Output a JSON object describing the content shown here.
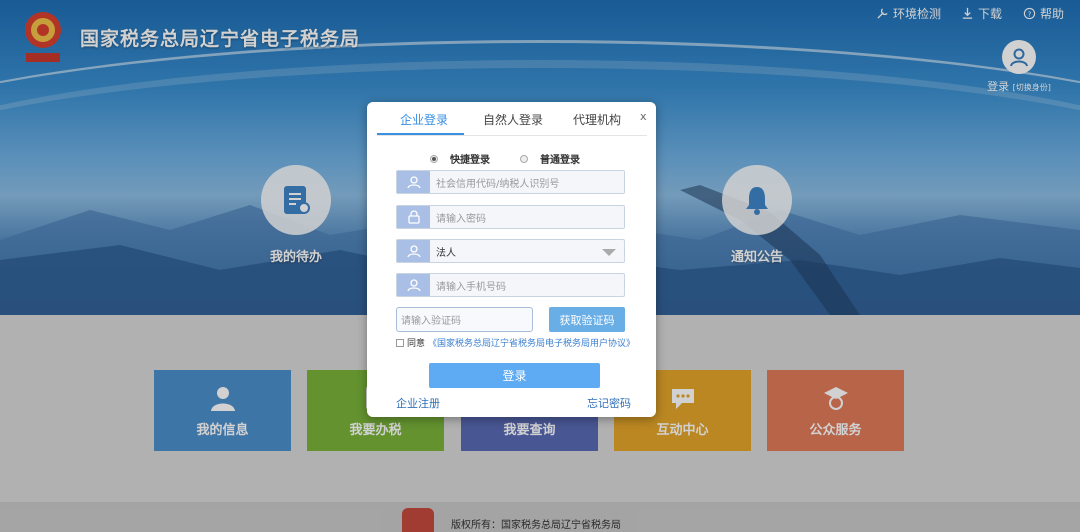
{
  "header": {
    "site_title": "国家税务总局辽宁省电子税务局",
    "links": [
      "环境检测",
      "下载",
      "帮助"
    ],
    "login": "登录",
    "switch_identity": "[切换身份]"
  },
  "hero": {
    "left_label": "我的待办",
    "right_label": "通知公告"
  },
  "tiles": [
    {
      "label": "我的信息",
      "color": "#4c8fcc"
    },
    {
      "label": "我要办税",
      "color": "#79b23a"
    },
    {
      "label": "我要查询",
      "color": "#5869b4"
    },
    {
      "label": "互动中心",
      "color": "#e3a52a"
    },
    {
      "label": "公众服务",
      "color": "#e07a5a"
    }
  ],
  "dialog": {
    "tabs": [
      "企业登录",
      "自然人登录",
      "代理机构"
    ],
    "close": "x",
    "login_modes": {
      "quick": "快捷登录",
      "normal": "普通登录"
    },
    "fields": {
      "credit_code_placeholder": "社会信用代码/纳税人识别号",
      "password_placeholder": "请输入密码",
      "role_value": "法人",
      "phone_placeholder": "请输入手机号码",
      "code_placeholder": "请输入验证码"
    },
    "get_code": "获取验证码",
    "agree_prefix": "同意",
    "agree_link": "《国家税务总局辽宁省税务局电子税务局用户协议》",
    "login_button": "登录",
    "register": "企业注册",
    "forgot": "忘记密码"
  },
  "footer": {
    "copyright": "版权所有：国家税务总局辽宁省税务局"
  },
  "colors": {
    "accent": "#3a8fe0",
    "login_button": "#5eaaf3",
    "field_icon_bg": "#a9bfe6"
  }
}
